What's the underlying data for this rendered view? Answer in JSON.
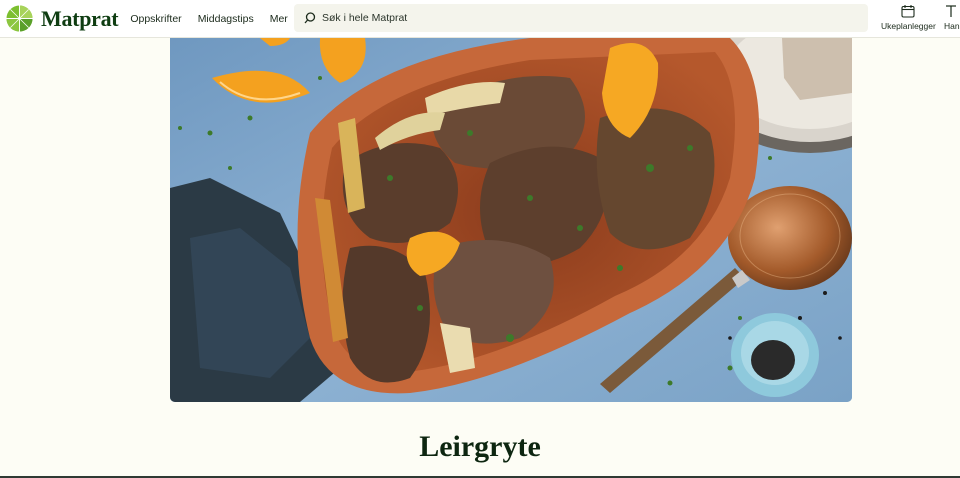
{
  "header": {
    "brand": "Matprat",
    "nav": [
      {
        "label": "Oppskrifter"
      },
      {
        "label": "Middagstips"
      },
      {
        "label": "Mer"
      }
    ],
    "search": {
      "placeholder": "Søk i hele Matprat"
    },
    "tools": [
      {
        "label": "Ukeplanlegger",
        "icon": "calendar-icon"
      },
      {
        "label": "Hand",
        "icon": "shopping-list-icon"
      }
    ]
  },
  "recipe": {
    "title": "Leirgryte"
  },
  "colors": {
    "brand_green": "#0f3d12",
    "page_bg": "#fdfdf5"
  }
}
